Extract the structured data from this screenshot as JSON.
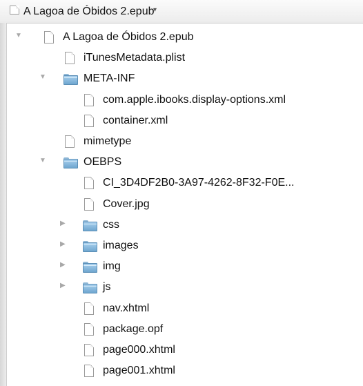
{
  "window": {
    "title": "A Lagoa de Óbidos 2.epub",
    "title_arrow": "▾"
  },
  "tree": [
    {
      "label": "A Lagoa de Óbidos 2.epub",
      "kind": "file",
      "level": 0,
      "disclosure": "expanded"
    },
    {
      "label": "iTunesMetadata.plist",
      "kind": "file",
      "level": 1,
      "disclosure": "none"
    },
    {
      "label": "META-INF",
      "kind": "folder",
      "level": 1,
      "disclosure": "expanded"
    },
    {
      "label": "com.apple.ibooks.display-options.xml",
      "kind": "file",
      "level": 2,
      "disclosure": "none"
    },
    {
      "label": "container.xml",
      "kind": "file",
      "level": 2,
      "disclosure": "none"
    },
    {
      "label": "mimetype",
      "kind": "file",
      "level": 1,
      "disclosure": "none"
    },
    {
      "label": "OEBPS",
      "kind": "folder",
      "level": 1,
      "disclosure": "expanded"
    },
    {
      "label": "CI_3D4DF2B0-3A97-4262-8F32-F0E...",
      "kind": "file",
      "level": 2,
      "disclosure": "none"
    },
    {
      "label": "Cover.jpg",
      "kind": "file",
      "level": 2,
      "disclosure": "none"
    },
    {
      "label": "css",
      "kind": "folder",
      "level": 2,
      "disclosure": "collapsed"
    },
    {
      "label": "images",
      "kind": "folder",
      "level": 2,
      "disclosure": "collapsed"
    },
    {
      "label": "img",
      "kind": "folder",
      "level": 2,
      "disclosure": "collapsed"
    },
    {
      "label": "js",
      "kind": "folder",
      "level": 2,
      "disclosure": "collapsed"
    },
    {
      "label": "nav.xhtml",
      "kind": "file",
      "level": 2,
      "disclosure": "none"
    },
    {
      "label": "package.opf",
      "kind": "file",
      "level": 2,
      "disclosure": "none"
    },
    {
      "label": "page000.xhtml",
      "kind": "file",
      "level": 2,
      "disclosure": "none"
    },
    {
      "label": "page001.xhtml",
      "kind": "file",
      "level": 2,
      "disclosure": "none"
    }
  ]
}
